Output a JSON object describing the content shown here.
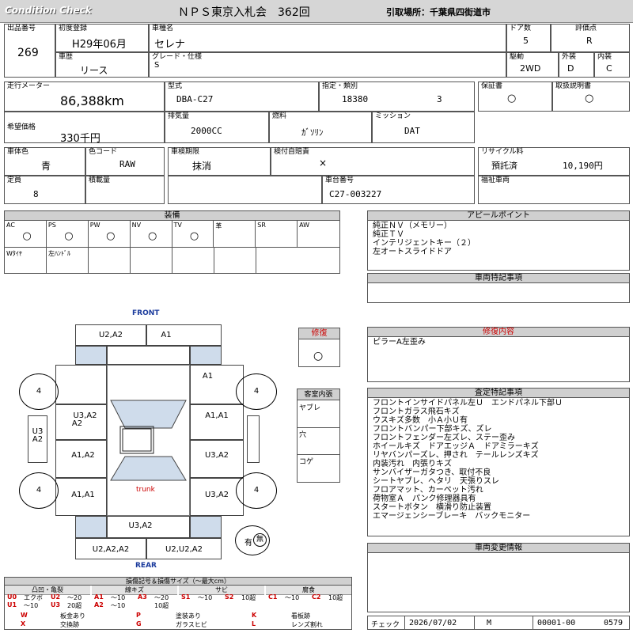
{
  "header": {
    "brand": "Condition  Check",
    "title": "ＮＰＳ東京入札会　362回",
    "pickup": "引取場所：千葉県四街道市"
  },
  "top": {
    "lot_label": "出品番号",
    "lot": "269",
    "first_reg_label": "初度登録",
    "first_reg": "H29年06月",
    "model_label": "車種名",
    "model": "セレナ",
    "doors_label": "ドア数",
    "doors": "5",
    "rating_label": "評価点",
    "rating": "R",
    "history_label": "車歴",
    "history": "リース",
    "grade_label": "グレード・仕様",
    "grade": "S",
    "drive_label": "駆動",
    "drive": "2WD",
    "ext_label": "外装",
    "ext": "D",
    "int_label": "内装",
    "int": "C"
  },
  "spec": {
    "mileage_label": "走行メーター",
    "mileage": "86,388km",
    "type_label": "型式",
    "type": "DBA-C27",
    "designation_label": "指定・類別",
    "designation": "18380",
    "category": "3",
    "warranty_label": "保証書",
    "warranty": "○",
    "manual_label": "取扱説明書",
    "manual": "○",
    "price_label": "希望価格",
    "price": "330千円",
    "displacement_label": "排気量",
    "displacement": "2000CC",
    "fuel_label": "燃料",
    "fuel": "ｶﾞｿﾘﾝ",
    "mission_label": "ミッション",
    "mission": "DAT",
    "color_label": "車体色",
    "color": "青",
    "colorcode_label": "色コード",
    "colorcode": "RAW",
    "inspection_label": "車検期限",
    "inspection": "抹消",
    "insurance_label": "検付自賠責",
    "insurance": "×",
    "recycle_label": "リサイクル料",
    "recycle_status": "預託済",
    "recycle": "10,190円",
    "capacity_label": "定員",
    "capacity": "8",
    "load_label": "積載量",
    "load": "",
    "chassis_label": "車台番号",
    "chassis": "C27-003227",
    "welfare_label": "福祉車両",
    "welfare": ""
  },
  "equipment": {
    "title": "装備",
    "row1": [
      {
        "label": "AC",
        "mark": "○"
      },
      {
        "label": "PS",
        "mark": "○"
      },
      {
        "label": "PW",
        "mark": "○"
      },
      {
        "label": "NV",
        "mark": "○"
      },
      {
        "label": "TV",
        "mark": "○"
      },
      {
        "label": "革",
        "mark": ""
      },
      {
        "label": "SR",
        "mark": ""
      },
      {
        "label": "AW",
        "mark": ""
      }
    ],
    "row2": [
      {
        "label": "Wﾀｲﾔ"
      },
      {
        "label": "左ﾊﾝﾄﾞﾙ"
      },
      {
        "label": ""
      },
      {
        "label": ""
      },
      {
        "label": ""
      },
      {
        "label": ""
      },
      {
        "label": ""
      }
    ]
  },
  "appeal": {
    "title": "アピールポイント",
    "lines": [
      "純正ＮＶ（メモリー）",
      "純正ＴＶ",
      "インテリジェントキー（２）",
      "左オートスライドドア"
    ]
  },
  "special": {
    "title": "車両特記事項"
  },
  "diagram": {
    "front": "FRONT",
    "rear": "REAR",
    "trunk": "trunk",
    "tire": "4",
    "top_left": "U2,A2",
    "top_right": "A1",
    "right_front": "A1",
    "left_front_door1": "U3,A2",
    "left_front_door2": "A2",
    "right_front_door": "A1,A1",
    "left_mirror1": "U3",
    "left_mirror2": "A2",
    "left_mid": "A1,A2",
    "right_mid": "U3,A2",
    "left_rear": "A1,A1",
    "right_rear": "U3,A2",
    "rear_top": "U3,A2",
    "rear_left": "U2,A2,A2",
    "rear_right": "U2,U2,A2",
    "spare_label": "有",
    "spare_mark": "無"
  },
  "repair": {
    "title": "修復",
    "mark": "○"
  },
  "cabin": {
    "title": "客室内張",
    "items": [
      "ヤブレ",
      "穴",
      "コゲ"
    ]
  },
  "repair_content": {
    "title": "修復内容",
    "lines": [
      "ピラーA左歪み"
    ]
  },
  "inspection_notes": {
    "title": "査定特記事項",
    "lines": [
      "フロントインサイドパネル左Ｕ　エンドパネル下部Ｕ",
      "フロントガラス飛石キズ",
      "ウスキズ多数　小Ａ小Ｕ有",
      "フロントバンパー下部キズ、ズレ",
      "フロントフェンダー左ズレ、ステー歪み",
      "ホイールキズ　ドアエッジＡ　ドアミラーキズ",
      "リヤバンパーズレ、押され　テールレンズキズ",
      "内装汚れ　内張りキズ",
      "サンバイザーガタつき、取付不良",
      "シートヤブレ、ヘタリ　天張りスレ",
      "フロアマット、カーペット汚れ",
      "荷物室Ａ　パンク修理器具有",
      "スタートボタン　横滑り防止装置",
      "エマージェンシーブレーキ　バックモニター"
    ]
  },
  "change": {
    "title": "車両変更情報"
  },
  "legend": {
    "title": "損傷記号＆損傷サイズ（～最大cm）",
    "headers": [
      "凸凹・亀裂",
      "線キズ",
      "サビ",
      "腐食"
    ],
    "row1": [
      {
        "code": "U0",
        "text": "エクボ"
      },
      {
        "code": "U2",
        "text": "～20"
      },
      {
        "code": "A1",
        "text": "～10"
      },
      {
        "code": "A3",
        "text": "～20"
      },
      {
        "code": "S1",
        "text": "～10"
      },
      {
        "code": "S2",
        "text": "10超"
      },
      {
        "code": "C1",
        "text": "～10"
      },
      {
        "code": "C2",
        "text": "10超"
      }
    ],
    "row2": [
      {
        "code": "U1",
        "text": "～10"
      },
      {
        "code": "U3",
        "text": "20超"
      },
      {
        "code": "A2",
        "text": "～10"
      },
      {
        "code": "",
        "text": "10超"
      }
    ],
    "bottom": [
      {
        "code": "W",
        "text": "板金あり"
      },
      {
        "code": "P",
        "text": "塗装あり"
      },
      {
        "code": "K",
        "text": "看板跡"
      },
      {
        "code": "X",
        "text": "交換跡"
      },
      {
        "code": "G",
        "text": "ガラスヒビ"
      },
      {
        "code": "L",
        "text": "レンズ割れ"
      }
    ]
  },
  "footer": {
    "check_label": "チェック",
    "date": "2026/07/02",
    "checker": "M",
    "number": "00001-00",
    "code": "0579"
  },
  "colors": {
    "header_bg": "#d0d0d0",
    "repair_red": "#cc0000",
    "panel_blue": "#cfdceb",
    "legend_code": "#cc0000"
  }
}
